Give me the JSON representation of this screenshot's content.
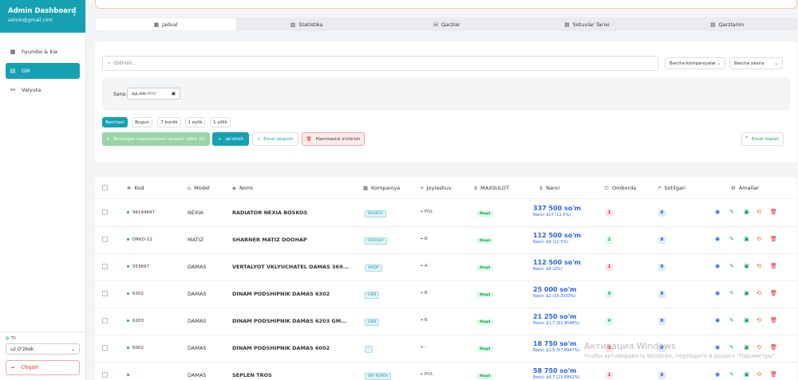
{
  "sidebar": {
    "title": "Admin Dashboard",
    "email": "admin@gmail.com",
    "items": [
      {
        "label": "hyundai & kia",
        "icon": "grid-icon"
      },
      {
        "label": "GM",
        "icon": "database-icon"
      },
      {
        "label": "Valyuta",
        "icon": "currency-icon"
      }
    ],
    "lang_label": "Til",
    "lang_value": "uz O'zbek",
    "logout_label": "Chiqish"
  },
  "tabs": [
    "Jadval",
    "Statistika",
    "Qarzlar",
    "Sotuvlar Tarixi",
    "Qarzlarim"
  ],
  "filters": {
    "search_placeholder": "Qidirish...",
    "company_dropdown": "Barcha kompaniyalar",
    "stock_dropdown": "Barcha zaxira",
    "date_label": "Sana:",
    "date_placeholder": "дд.мм.гггг",
    "periods": [
      "Barchasi",
      "Bugun",
      "7 kunlik",
      "1 oylik",
      "1 yillik"
    ],
    "export_selected_label": "Tanlangan mahsulotlarni eksport qilish (0)",
    "add_label": "qo'shish",
    "excel_export_label": "Excel eksport",
    "delete_all_label": "Hammasini o'chirish",
    "excel_import_label": "Excel import"
  },
  "table": {
    "headers": [
      "Kod",
      "Model",
      "Nomi",
      "Kompaniya",
      "Joylashuv",
      "MAXSULOT",
      "Narxi",
      "Omborda",
      "Sotilgan",
      "Amallar"
    ],
    "rows": [
      {
        "kod": "96144847",
        "model": "NEXIA",
        "nomi": "RADIATOR NEXIA BOSKOS",
        "kompaniya": "BOSKOS",
        "joylashuv": "POL",
        "maxsulot": "Naqd",
        "narxi": "337 500 so'm",
        "narxi_sub": "Narxi: $27 (12.5%)",
        "omborda": "1",
        "sotilgan": "0"
      },
      {
        "kod": "DRKD-12",
        "model": "MATIZ",
        "nomi": "SHARNER MATIZ DOOHAP",
        "kompaniya": "DOOHAP",
        "joylashuv": "B",
        "maxsulot": "Naqd",
        "narxi": "112 500 so'm",
        "narxi_sub": "Narxi: $9 (12.5%)",
        "omborda": "2",
        "sotilgan": "0"
      },
      {
        "kod": "553697",
        "model": "DAMAS",
        "nomi": "VERTALYOT VKLYUCHATEL DAMAS 369...",
        "kompaniya": "WKQP",
        "joylashuv": "A",
        "maxsulot": "Naqd",
        "narxi": "112 500 so'm",
        "narxi_sub": "Narxi: $9 (2%)",
        "omborda": "1",
        "sotilgan": "0"
      },
      {
        "kod": "6302",
        "model": "DAMAS",
        "nomi": "DINAM PODSHIPNIK DAMAS 6302",
        "kompaniya": "GMB",
        "joylashuv": "B",
        "maxsulot": "Naqd",
        "narxi": "25 000 so'm",
        "narxi_sub": "Narxi: $2 (33.3333%)",
        "omborda": "4",
        "sotilgan": "0"
      },
      {
        "kod": "6203",
        "model": "DAMAS",
        "nomi": "DINAM PODSHIPNIK DAMAS 6203 GM...",
        "kompaniya": "GMB",
        "joylashuv": "B",
        "maxsulot": "Naqd",
        "narxi": "21 250 so'm",
        "narxi_sub": "Narxi: $1,7 (61.9048%)",
        "omborda": "4",
        "sotilgan": "0"
      },
      {
        "kod": "6002",
        "model": "DAMAS",
        "nomi": "DINAM PODSHIPNIK DAMAS 6002",
        "kompaniya": "-",
        "joylashuv": "-",
        "maxsulot": "Naqd",
        "narxi": "18 750 so'm",
        "narxi_sub": "Narxi: $1,5 (57.8947%)",
        "omborda": "3",
        "sotilgan": "0"
      },
      {
        "kod": "",
        "model": "DAMAS",
        "nomi": "SEPLEN TROS",
        "kompaniya": "SKY KOREA",
        "joylashuv": "POL",
        "maxsulot": "Naqd",
        "narxi": "58 750 so'm",
        "narxi_sub": "Narxi: $4,7 (23.6842%)",
        "omborda": "1",
        "sotilgan": "0"
      }
    ]
  },
  "watermark": {
    "line1": "Активация Windows",
    "line2": "Чтобы активировать Windows, перейдите в раздел \"Параметры\"."
  },
  "colors": {
    "brand": "#16a1b3",
    "price": "#2563eb",
    "success": "#16a34a",
    "danger": "#dc2626"
  }
}
